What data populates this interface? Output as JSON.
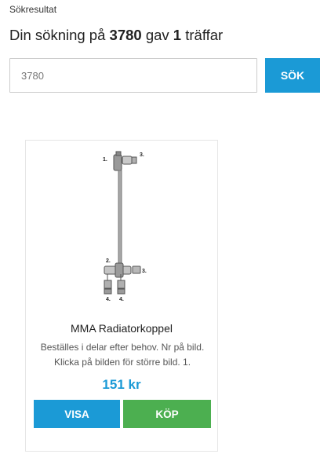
{
  "breadcrumb": "Sökresultat",
  "title": {
    "prefix": "Din sökning på",
    "query": "3780",
    "middle": "gav",
    "count": "1",
    "suffix": "träffar"
  },
  "search": {
    "value": "3780",
    "button_label": "SÖK"
  },
  "products": [
    {
      "name": "MMA Radiatorkoppel",
      "description": "Beställes i delar efter behov. Nr på bild. Klicka på bilden för större bild. 1.",
      "price": "151 kr",
      "view_label": "VISA",
      "buy_label": "KÖP",
      "image_labels": [
        "1.",
        "3.",
        "2.",
        "3.",
        "4.",
        "4."
      ]
    }
  ],
  "colors": {
    "accent": "#1b9ad6",
    "buy": "#4caf50"
  }
}
